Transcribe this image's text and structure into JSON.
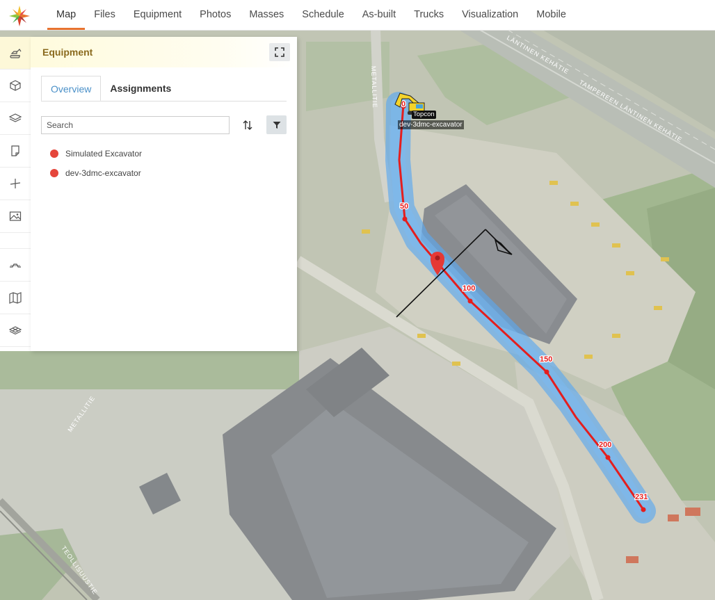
{
  "nav": {
    "logo_icon": "compass-star-logo",
    "items": [
      "Map",
      "Files",
      "Equipment",
      "Photos",
      "Masses",
      "Schedule",
      "As-built",
      "Trucks",
      "Visualization",
      "Mobile"
    ],
    "active": "Map",
    "accent_color": "#e8732f"
  },
  "rail": {
    "icons": [
      "excavator-icon",
      "cube-icon",
      "layers-icon",
      "note-icon",
      "crosshair-icon",
      "image-icon",
      "cross-section-icon",
      "map-icon",
      "stack-icon"
    ]
  },
  "panel": {
    "title": "Equipment",
    "tabs": [
      "Overview",
      "Assignments"
    ],
    "active_tab": "Overview",
    "search_placeholder": "Search",
    "items": [
      {
        "name": "Simulated Excavator",
        "status_color": "#e5463b"
      },
      {
        "name": "dev-3dmc-excavator",
        "status_color": "#e5463b"
      }
    ]
  },
  "map": {
    "street_labels": [
      "TAMPEREEN LÄNTINEN KEHÄTIE",
      "LÄNTINEN KEHÄTIE",
      "METALLITIE",
      "METALLITIE",
      "TEOLLISUUSTIE"
    ],
    "route_stations": [
      "0",
      "50",
      "100",
      "150",
      "200",
      "231"
    ],
    "vehicle_tag": "Topcon",
    "vehicle_label": "dev-3dmc-excavator",
    "route_color": "#e41e1e",
    "corridor_color": "#5aa8f0"
  }
}
